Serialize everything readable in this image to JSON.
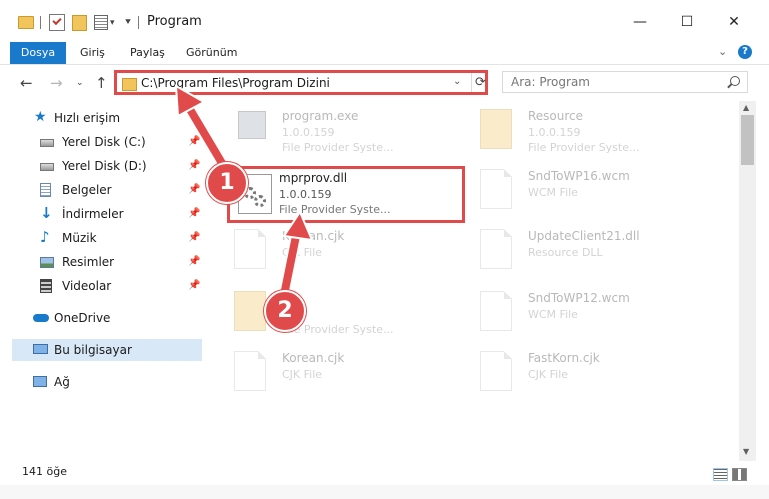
{
  "window": {
    "title": "Program",
    "controls": {
      "minimize": "—",
      "maximize": "☐",
      "close": "✕"
    }
  },
  "ribbon": {
    "tabs": [
      "Dosya",
      "Giriş",
      "Paylaş",
      "Görünüm"
    ]
  },
  "navigation": {
    "address": "C:\\Program Files\\Program Dizini",
    "search_placeholder": "Ara: Program"
  },
  "sidebar": {
    "quick_access": "Hızlı erişim",
    "items": [
      {
        "label": "Yerel Disk (C:)",
        "icon": "drive-icon"
      },
      {
        "label": "Yerel Disk (D:)",
        "icon": "drive-icon"
      },
      {
        "label": "Belgeler",
        "icon": "documents-icon"
      },
      {
        "label": "İndirmeler",
        "icon": "download-icon"
      },
      {
        "label": "Müzik",
        "icon": "music-icon"
      },
      {
        "label": "Resimler",
        "icon": "pictures-icon"
      },
      {
        "label": "Videolar",
        "icon": "videos-icon"
      }
    ],
    "onedrive": "OneDrive",
    "this_pc": "Bu bilgisayar",
    "network": "Ağ"
  },
  "files": {
    "left": [
      {
        "name": "program.exe",
        "version": "1.0.0.159",
        "desc": "File Provider Syste..."
      },
      {
        "name": "mprprov.dll",
        "version": "1.0.0.159",
        "desc": "File Provider Syste..."
      },
      {
        "name": "Korean.cjk",
        "type": "CJK File"
      },
      {
        "name": "",
        "version": "59",
        "desc": "File Provider Syste..."
      },
      {
        "name": "Korean.cjk",
        "type": "CJK File"
      }
    ],
    "right": [
      {
        "name": "Resource",
        "version": "1.0.0.159",
        "desc": "File Provider Syste..."
      },
      {
        "name": "SndToWP16.wcm",
        "type": "WCM File"
      },
      {
        "name": "UpdateClient21.dll",
        "type": "Resource DLL"
      },
      {
        "name": "SndToWP12.wcm",
        "type": "WCM File"
      },
      {
        "name": "FastKorn.cjk",
        "type": "CJK File"
      }
    ]
  },
  "markers": [
    "1",
    "2"
  ],
  "status": {
    "count": "141 öğe"
  },
  "colors": {
    "accent": "#1979ca",
    "highlight": "#e04a4a",
    "selection": "#d9e8f7"
  }
}
